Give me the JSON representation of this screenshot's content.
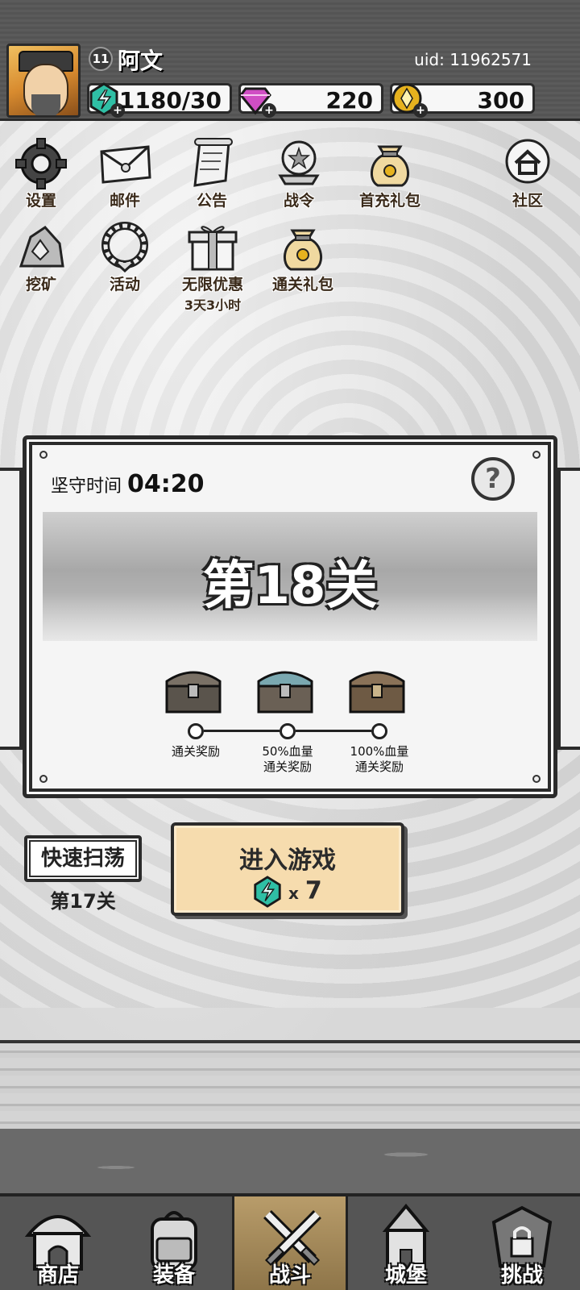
{
  "player": {
    "level": "11",
    "name": "阿文",
    "uid": "uid: 11962571"
  },
  "resources": [
    {
      "icon": "energy-gem-icon",
      "value": "1180/30"
    },
    {
      "icon": "diamond-icon",
      "value": "220"
    },
    {
      "icon": "gold-coin-icon",
      "value": "300"
    }
  ],
  "menu": [
    {
      "icon": "gear-icon",
      "label": "设置"
    },
    {
      "icon": "mail-icon",
      "label": "邮件"
    },
    {
      "icon": "scroll-icon",
      "label": "公告"
    },
    {
      "icon": "battle-pass-icon",
      "label": "战令"
    },
    {
      "icon": "gift-bag-icon",
      "label": "首充礼包"
    },
    {
      "icon": "home-icon",
      "label": "社区"
    },
    {
      "icon": "mining-icon",
      "label": "挖矿"
    },
    {
      "icon": "wreath-icon",
      "label": "活动"
    },
    {
      "icon": "gift-box-icon",
      "label": "无限优惠",
      "sub": "3天3小时"
    },
    {
      "icon": "gift-bag-icon",
      "label": "通关礼包"
    }
  ],
  "stage": {
    "defend_label": "坚守时间",
    "defend_time": "04:20",
    "title": "第18关",
    "rewards": [
      {
        "line1": "通关奖励",
        "line2": ""
      },
      {
        "line1": "50%血量",
        "line2": "通关奖励"
      },
      {
        "line1": "100%血量",
        "line2": "通关奖励"
      }
    ]
  },
  "sweep": {
    "label": "快速扫荡",
    "stage": "第17关"
  },
  "enter": {
    "label": "进入游戏",
    "cost_x": "x",
    "cost": "7"
  },
  "nav": [
    {
      "label": "商店",
      "icon": "shop-hut-icon"
    },
    {
      "label": "装备",
      "icon": "backpack-icon"
    },
    {
      "label": "战斗",
      "icon": "crossed-swords-icon",
      "active": true
    },
    {
      "label": "城堡",
      "icon": "castle-icon"
    },
    {
      "label": "挑战",
      "icon": "locked-challenge-icon"
    }
  ],
  "colors": {
    "accent_button": "#f6dcae",
    "energy": "#2fbfa5",
    "diamond": "#d04ec4",
    "gold": "#e6b21e",
    "active_tab": "#b89c6a"
  }
}
